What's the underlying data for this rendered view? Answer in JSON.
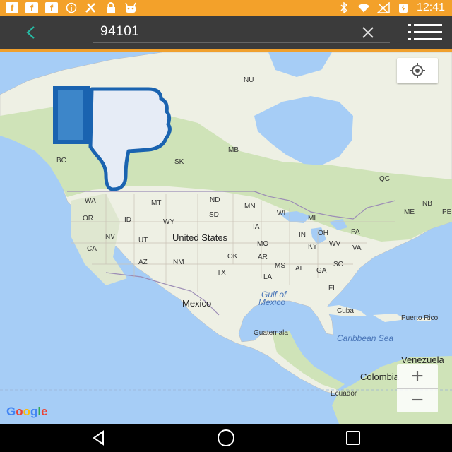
{
  "status_bar": {
    "icons": [
      "facebook-icon",
      "facebook-icon",
      "facebook-icon",
      "info-icon",
      "tools-icon",
      "lock-icon",
      "android-icon",
      "bluetooth-icon",
      "wifi-icon",
      "no-signal-icon",
      "battery-charging-icon"
    ],
    "fb_glyph": "f",
    "time": "12:41"
  },
  "toolbar": {
    "search_query": "94101"
  },
  "map": {
    "labels": {
      "nu": "NU",
      "mb": "MB",
      "sk": "SK",
      "bc": "BC",
      "qc": "QC",
      "nb": "NB",
      "me": "ME",
      "pe": "PE",
      "wa": "WA",
      "mt": "MT",
      "nd": "ND",
      "mn": "MN",
      "wi": "WI",
      "mi": "MI",
      "or": "OR",
      "id": "ID",
      "wy": "WY",
      "sd": "SD",
      "ia": "IA",
      "in": "IN",
      "oh": "OH",
      "pa": "PA",
      "nv": "NV",
      "ut": "UT",
      "ca": "CA",
      "mo": "MO",
      "ky": "KY",
      "wv": "WV",
      "va": "VA",
      "ok": "OK",
      "ar": "AR",
      "az": "AZ",
      "nm": "NM",
      "tx": "TX",
      "ms": "MS",
      "al": "AL",
      "ga": "GA",
      "sc": "SC",
      "la": "LA",
      "fl": "FL",
      "usa": "United States",
      "mexico": "Mexico",
      "gulf1": "Gulf of",
      "gulf2": "Mexico",
      "cuba": "Cuba",
      "puerto_rico": "Puerto Rico",
      "guatemala": "Guatemala",
      "caribbean": "Caribbean Sea",
      "venezuela": "Venezuela",
      "colombia": "Colombia",
      "ecuador": "Ecuador"
    },
    "zoom_in": "+",
    "zoom_out": "−",
    "logo_letters": [
      "G",
      "o",
      "o",
      "g",
      "l",
      "e"
    ]
  },
  "colors": {
    "status_bar": "#f3a12a",
    "toolbar": "#3b3b3b",
    "accent_back": "#26b9a3",
    "water": "#a6cdf6",
    "land": "#eef0e4",
    "forest": "#cfe3b8",
    "thumb_blue": "#1a63b0",
    "thumb_fill": "#e6ecf6"
  }
}
